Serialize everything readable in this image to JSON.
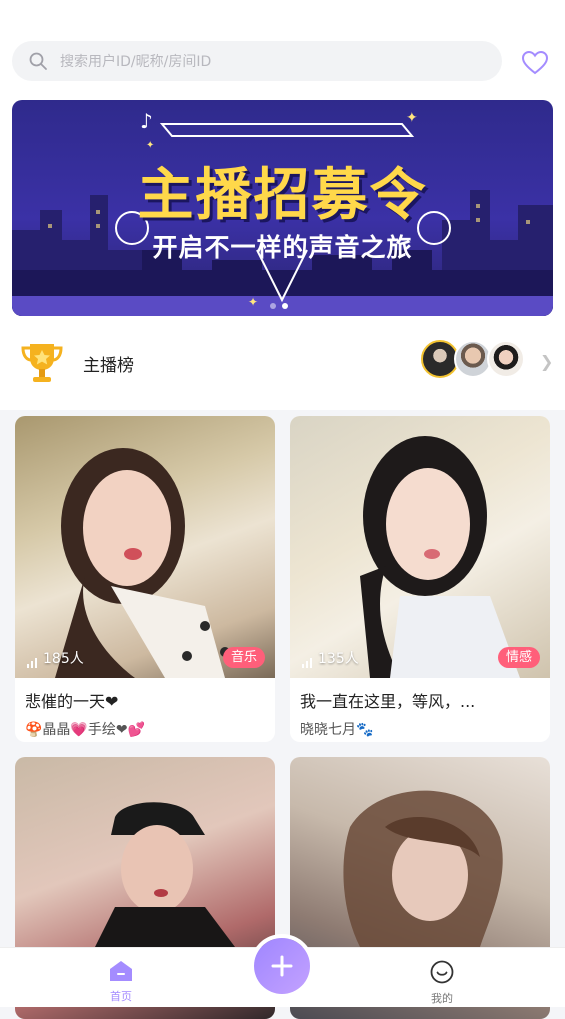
{
  "search": {
    "placeholder": "搜索用户ID/昵称/房间ID"
  },
  "banner": {
    "title": "主播招募令",
    "subtitle": "开启不一样的声音之旅"
  },
  "rank": {
    "label": "主播榜"
  },
  "rooms": [
    {
      "listeners": "185人",
      "tag": "音乐",
      "title": "悲催的一天❤",
      "host": "🍄晶晶💗手绘❤💕"
    },
    {
      "listeners": "135人",
      "tag": "情感",
      "title": "我一直在这里，等风，...",
      "host": "晓晓七月🐾"
    },
    {
      "listeners": "",
      "tag": "",
      "title": "",
      "host": ""
    },
    {
      "listeners": "",
      "tag": "",
      "title": "",
      "host": ""
    }
  ],
  "nav": {
    "home": "首页",
    "mine": "我的"
  },
  "colors": {
    "accent": "#a48cff",
    "tag": "#ff5f7a",
    "trophy": "#f5b21f"
  },
  "icons": [
    "search-icon",
    "heart-icon",
    "trophy-icon",
    "chevron-right-icon",
    "home-icon",
    "plus-icon",
    "profile-icon"
  ]
}
